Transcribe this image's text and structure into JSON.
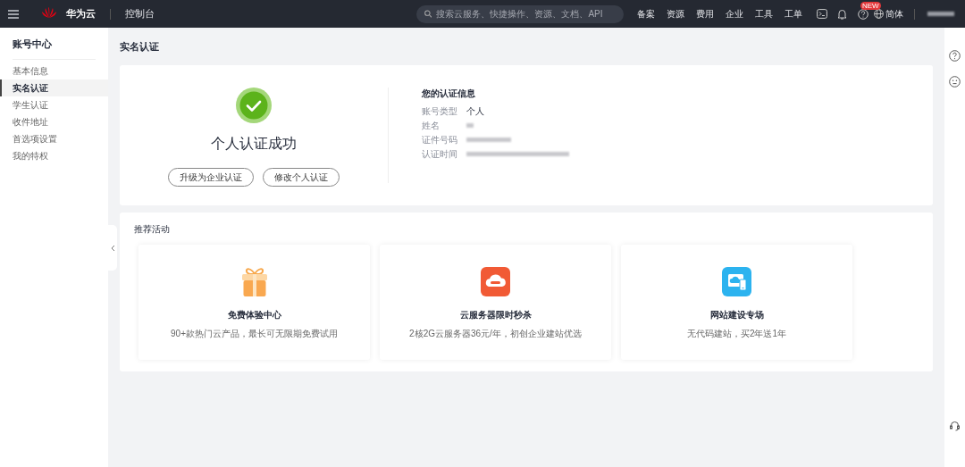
{
  "header": {
    "brand": "华为云",
    "console": "控制台",
    "search": {
      "placeholder": "搜索云服务、快捷操作、资源、文档、API"
    },
    "nav": [
      "备案",
      "资源",
      "费用",
      "企业",
      "工具",
      "工单"
    ],
    "new_badge": "NEW",
    "language": "简体"
  },
  "sidebar": {
    "title": "账号中心",
    "items": [
      {
        "label": "基本信息",
        "selected": false
      },
      {
        "label": "实名认证",
        "selected": true
      },
      {
        "label": "学生认证",
        "selected": false
      },
      {
        "label": "收件地址",
        "selected": false
      },
      {
        "label": "首选项设置",
        "selected": false
      },
      {
        "label": "我的特权",
        "selected": false
      }
    ]
  },
  "page_title": "实名认证",
  "status": {
    "title": "个人认证成功",
    "buttons": [
      "升级为企业认证",
      "修改个人认证"
    ]
  },
  "info": {
    "title": "您的认证信息",
    "rows": [
      {
        "label": "账号类型",
        "value": "个人"
      },
      {
        "label": "姓名",
        "redacted": true
      },
      {
        "label": "证件号码",
        "redacted": true
      },
      {
        "label": "认证时间",
        "redacted": true
      }
    ]
  },
  "promotions": {
    "title": "推荐活动",
    "cards": [
      {
        "kind": "gift",
        "title": "免费体验中心",
        "desc": "90+款热门云产品，最长可无限期免费试用"
      },
      {
        "kind": "cloud",
        "title": "云服务器限时秒杀",
        "desc": "2核2G云服务器36元/年，初创企业建站优选"
      },
      {
        "kind": "site",
        "title": "网站建设专场",
        "desc": "无代码建站，买2年送1年"
      }
    ]
  }
}
